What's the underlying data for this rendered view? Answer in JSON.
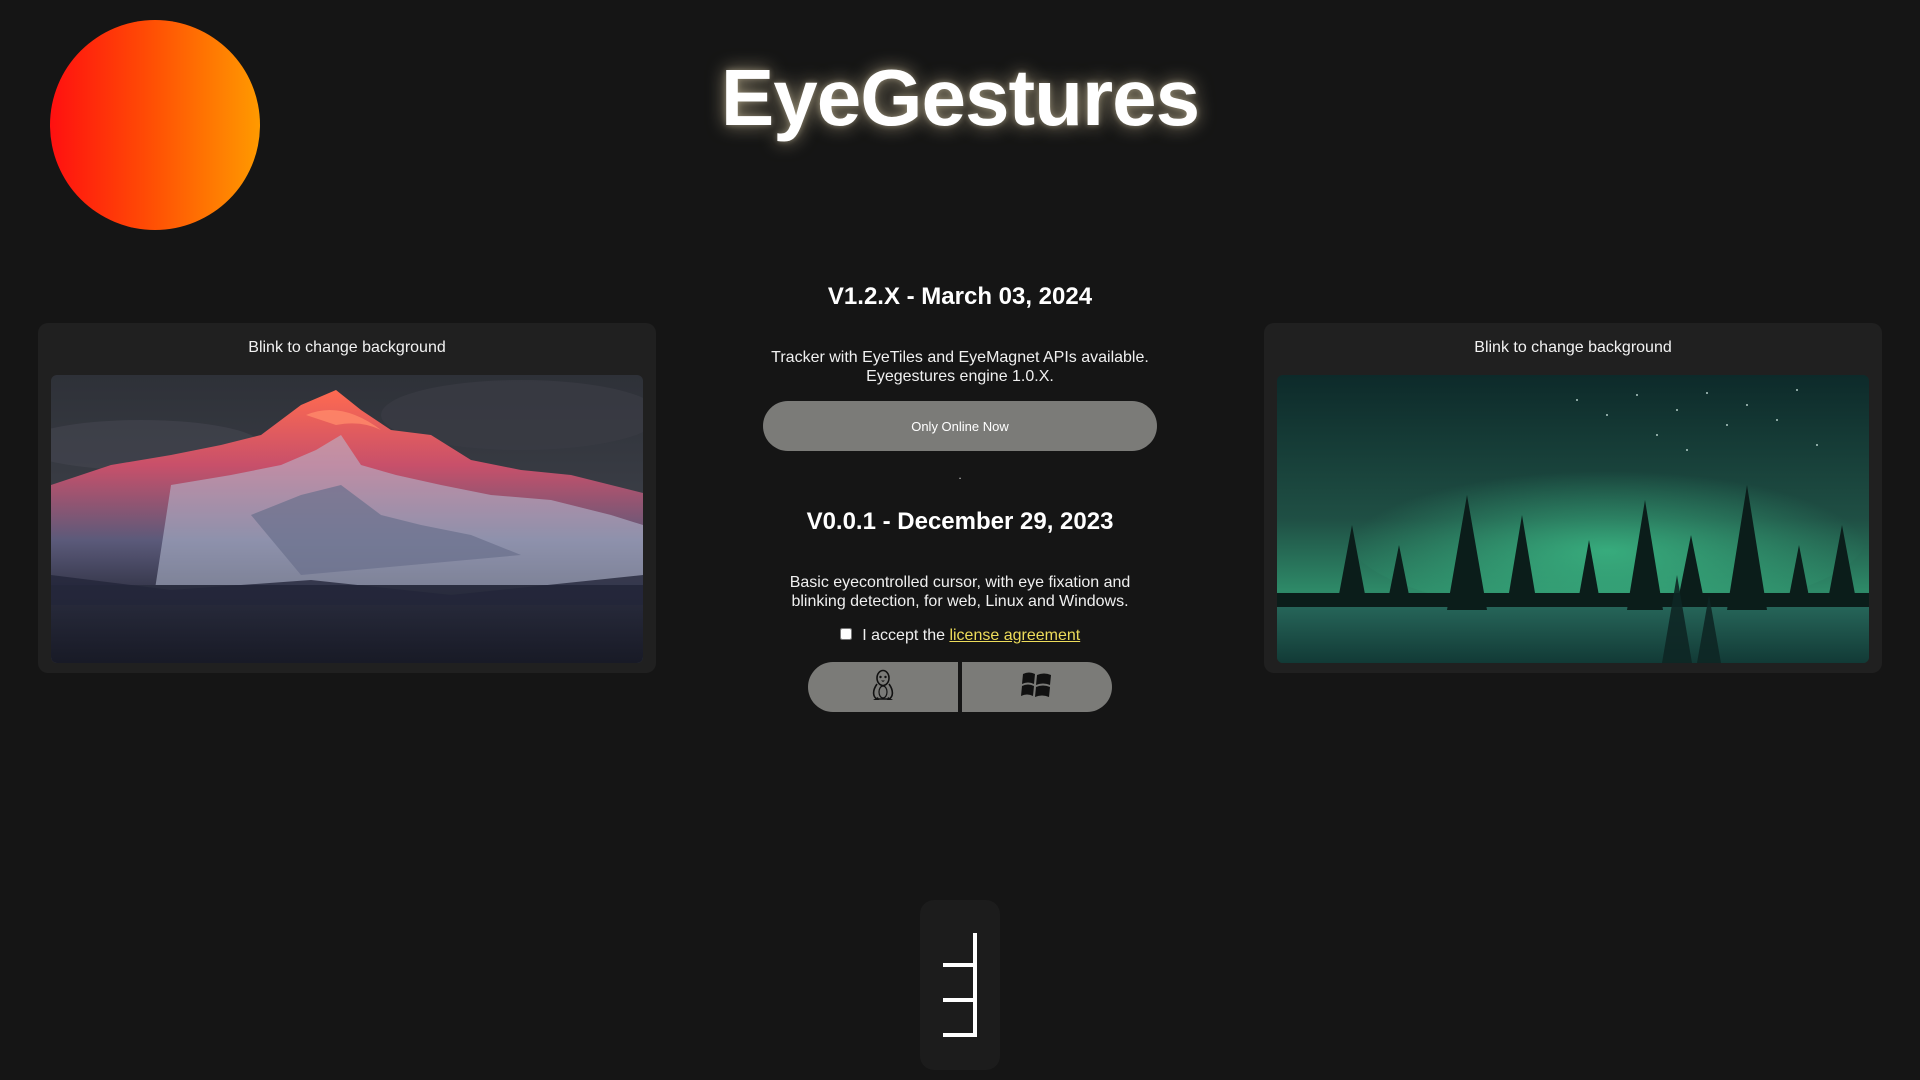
{
  "header": {
    "title": "EyeGestures"
  },
  "left_panel": {
    "label": "Blink to change background",
    "image": "snowy mountain peak at sunset"
  },
  "right_panel": {
    "label": "Blink to change background",
    "image": "northern lights over snowy forest"
  },
  "releases": [
    {
      "heading": "V1.2.X - March 03, 2024",
      "description_line1": "Tracker with EyeTiles and EyeMagnet APIs available.",
      "description_line2": "Eyegestures engine 1.0.X.",
      "button_label": "Only Online Now"
    },
    {
      "heading": "V0.0.1 - December 29, 2023",
      "description_line1": "Basic eyecontrolled cursor, with eye fixation and",
      "description_line2": "blinking detection, for web, Linux and Windows."
    }
  ],
  "separator": ".",
  "license": {
    "prefix": "I accept the",
    "link_text": "license agreement",
    "checked": false
  },
  "downloads": [
    {
      "os": "Linux",
      "icon": "linux-tux-icon"
    },
    {
      "os": "Windows",
      "icon": "windows-logo-icon"
    }
  ],
  "bottom_widget": {
    "icon": "ladder-logo-icon"
  },
  "colors": {
    "background": "#151515",
    "card": "#202020",
    "button": "#7b7b78",
    "link": "#eddc5a",
    "orb_start": "#ff1010",
    "orb_end": "#ff9a00"
  }
}
